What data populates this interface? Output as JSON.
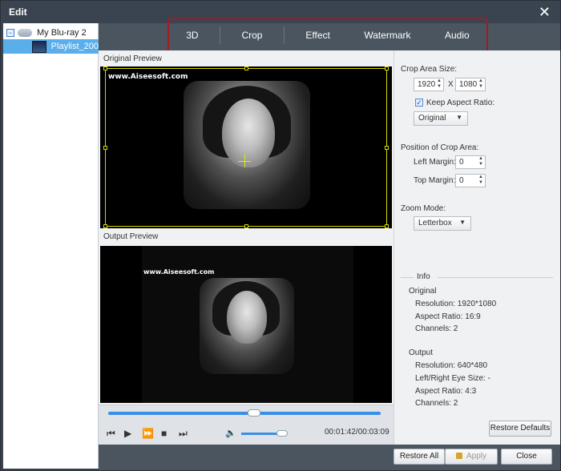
{
  "window": {
    "title": "Edit"
  },
  "tree": {
    "root_label": "My Blu-ray 2",
    "child_label": "Playlist_200"
  },
  "tabs": [
    {
      "label": "3D"
    },
    {
      "label": "Crop",
      "active": true
    },
    {
      "label": "Effect"
    },
    {
      "label": "Watermark"
    },
    {
      "label": "Audio"
    }
  ],
  "preview": {
    "original_label": "Original Preview",
    "output_label": "Output Preview",
    "watermark_text": "www.Aiseesoft.com"
  },
  "player": {
    "seek_fraction": 0.55,
    "volume_fraction": 0.78,
    "time": "00:01:42/00:03:09",
    "volume_icon": "speaker-icon"
  },
  "crop": {
    "area_size_label": "Crop Area Size:",
    "width": "1920",
    "x_label": "X",
    "height": "1080",
    "keep_aspect_label": "Keep Aspect Ratio:",
    "keep_aspect_checked": true,
    "aspect_value": "Original",
    "position_label": "Position of Crop Area:",
    "left_margin_label": "Left Margin:",
    "left_margin": "0",
    "top_margin_label": "Top Margin:",
    "top_margin": "0",
    "zoom_label": "Zoom Mode:",
    "zoom_value": "Letterbox"
  },
  "info": {
    "title": "Info",
    "original_title": "Original",
    "orig_resolution": "Resolution: 1920*1080",
    "orig_aspect": "Aspect Ratio: 16:9",
    "orig_channels": "Channels: 2",
    "output_title": "Output",
    "out_resolution": "Resolution: 640*480",
    "out_eye_size": "Left/Right Eye Size: -",
    "out_aspect": "Aspect Ratio: 4:3",
    "out_channels": "Channels: 2"
  },
  "buttons": {
    "restore_defaults": "Restore Defaults",
    "restore_all": "Restore All",
    "apply": "Apply",
    "close": "Close"
  },
  "colors": {
    "titlebar": "#3a4350",
    "tab_highlight_border": "#a01c24",
    "selected_item": "#5aaeea",
    "crop_frame": "#d5d800",
    "slider": "#3a8ee6"
  }
}
